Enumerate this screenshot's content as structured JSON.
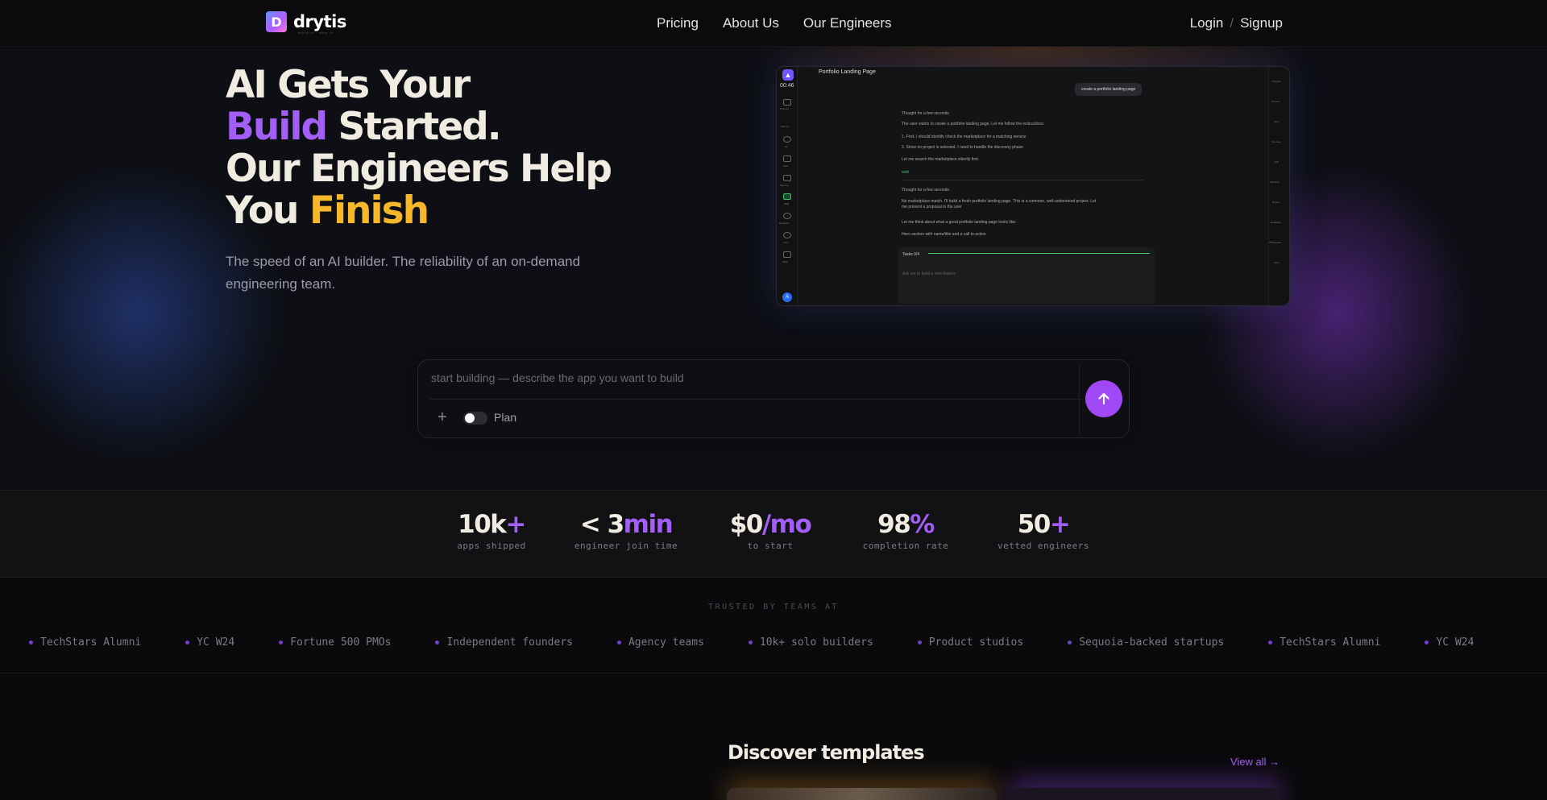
{
  "brand": {
    "name": "drytis",
    "tagline": "build it · ship it"
  },
  "nav": {
    "links": [
      "Pricing",
      "About Us",
      "Our Engineers"
    ],
    "login": "Login",
    "separator": "/",
    "signup": "Signup"
  },
  "hero": {
    "line1": "AI Gets Your",
    "line2_accent": "Build",
    "line2_rest": " Started.",
    "line3": "Our Engineers Help",
    "line4_start": "You ",
    "line4_accent": "Finish",
    "subtitle": "The speed of an AI builder. The reliability of an on-demand engineering team."
  },
  "preview": {
    "time": "00:46",
    "title": "Portfolio Landing Page",
    "chip": "create a portfolio landing page",
    "thought1": "Thought for a few seconds",
    "text1": "The user wants to create a portfolio landing page. Let me follow the instructions:",
    "step1": "1. First, I should identify check the marketplace for a matching service",
    "step2": "2. Since no project is selected, I need to handle the discovery phase",
    "text2": "Let me search the marketplace silently first.",
    "tool": "web",
    "thought2": "Thought for a few seconds",
    "text3": "No marketplace match. I'll build a fresh portfolio landing page. This is a common, well-understood project. Let",
    "text4": "me present a proposal to the user",
    "text5": "Let me think about what a good portfolio landing page looks like:",
    "bullet": "Hero section with name/title and a call to action",
    "task": "Tasks 0/4",
    "input": "Ask me to build a new feature",
    "avatar": "A",
    "sidebar_left": [
      "Projects",
      "Planner",
      "Info",
      "Diffs",
      "Meeting",
      "Help",
      "Requests",
      "View",
      "Skills"
    ],
    "sidebar_right": [
      "Threads",
      "Preview",
      "Files",
      "Terminal",
      "Edit",
      "Identities",
      "Deploy",
      "Database",
      "Whitespace",
      "More"
    ]
  },
  "prompt": {
    "placeholder": "start building — describe the app you want to build",
    "plus": "+",
    "plan_label": "Plan",
    "plan_on": false
  },
  "stats": [
    {
      "main": "10k",
      "accent": "+",
      "label": "apps shipped"
    },
    {
      "main": "< 3",
      "accent": "min",
      "label": "engineer join time"
    },
    {
      "main": "$0",
      "accent": "/mo",
      "label": "to start"
    },
    {
      "main": "98",
      "accent": "%",
      "label": "completion rate"
    },
    {
      "main": "50",
      "accent": "+",
      "label": "vetted engineers"
    }
  ],
  "trusted": {
    "title": "TRUSTED BY TEAMS AT",
    "items": [
      "TechStars Alumni",
      "YC W24",
      "Fortune 500 PMOs",
      "Independent founders",
      "Agency teams",
      "10k+ solo builders",
      "Product studios",
      "Sequoia-backed startups",
      "TechStars Alumni",
      "YC W24"
    ]
  },
  "templates": {
    "title": "Discover templates",
    "view_all": "View all →"
  },
  "colors": {
    "accent_purple": "#a35ef5",
    "accent_yellow": "#f6b72b",
    "send_button": "#a148f6"
  }
}
